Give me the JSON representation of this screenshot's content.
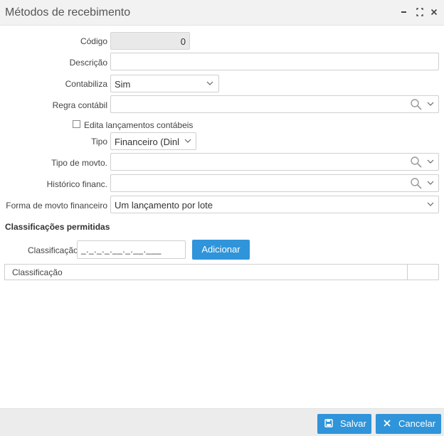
{
  "window": {
    "title": "Métodos de recebimento",
    "minimize_icon": "minimize-icon",
    "maximize_icon": "maximize-icon",
    "close_icon": "close-icon"
  },
  "form": {
    "codigo_label": "Código",
    "codigo_value": "0",
    "descricao_label": "Descrição",
    "descricao_value": "",
    "contabiliza_label": "Contabiliza",
    "contabiliza_value": "Sim",
    "regra_label": "Regra contábil",
    "regra_value": "",
    "edita_label": "Edita lançamentos contábeis",
    "edita_checked": false,
    "tipo_label": "Tipo",
    "tipo_value": "Financeiro (Dinl",
    "tipo_movto_label": "Tipo de movto.",
    "tipo_movto_value": "",
    "historico_label": "Histórico financ.",
    "historico_value": "",
    "forma_label": "Forma de movto financeiro",
    "forma_value": "Um lançamento por lote"
  },
  "classificacoes": {
    "section_title": "Classificações permitidas",
    "label": "Classificação",
    "input_mask": "_._._._.__._.__.___",
    "add_button": "Adicionar",
    "table_header": "Classificação"
  },
  "footer": {
    "save_label": "Salvar",
    "cancel_label": "Cancelar"
  },
  "colors": {
    "accent": "#2f94d9",
    "titlebar": "#f2f2f2",
    "footer": "#ececec"
  }
}
